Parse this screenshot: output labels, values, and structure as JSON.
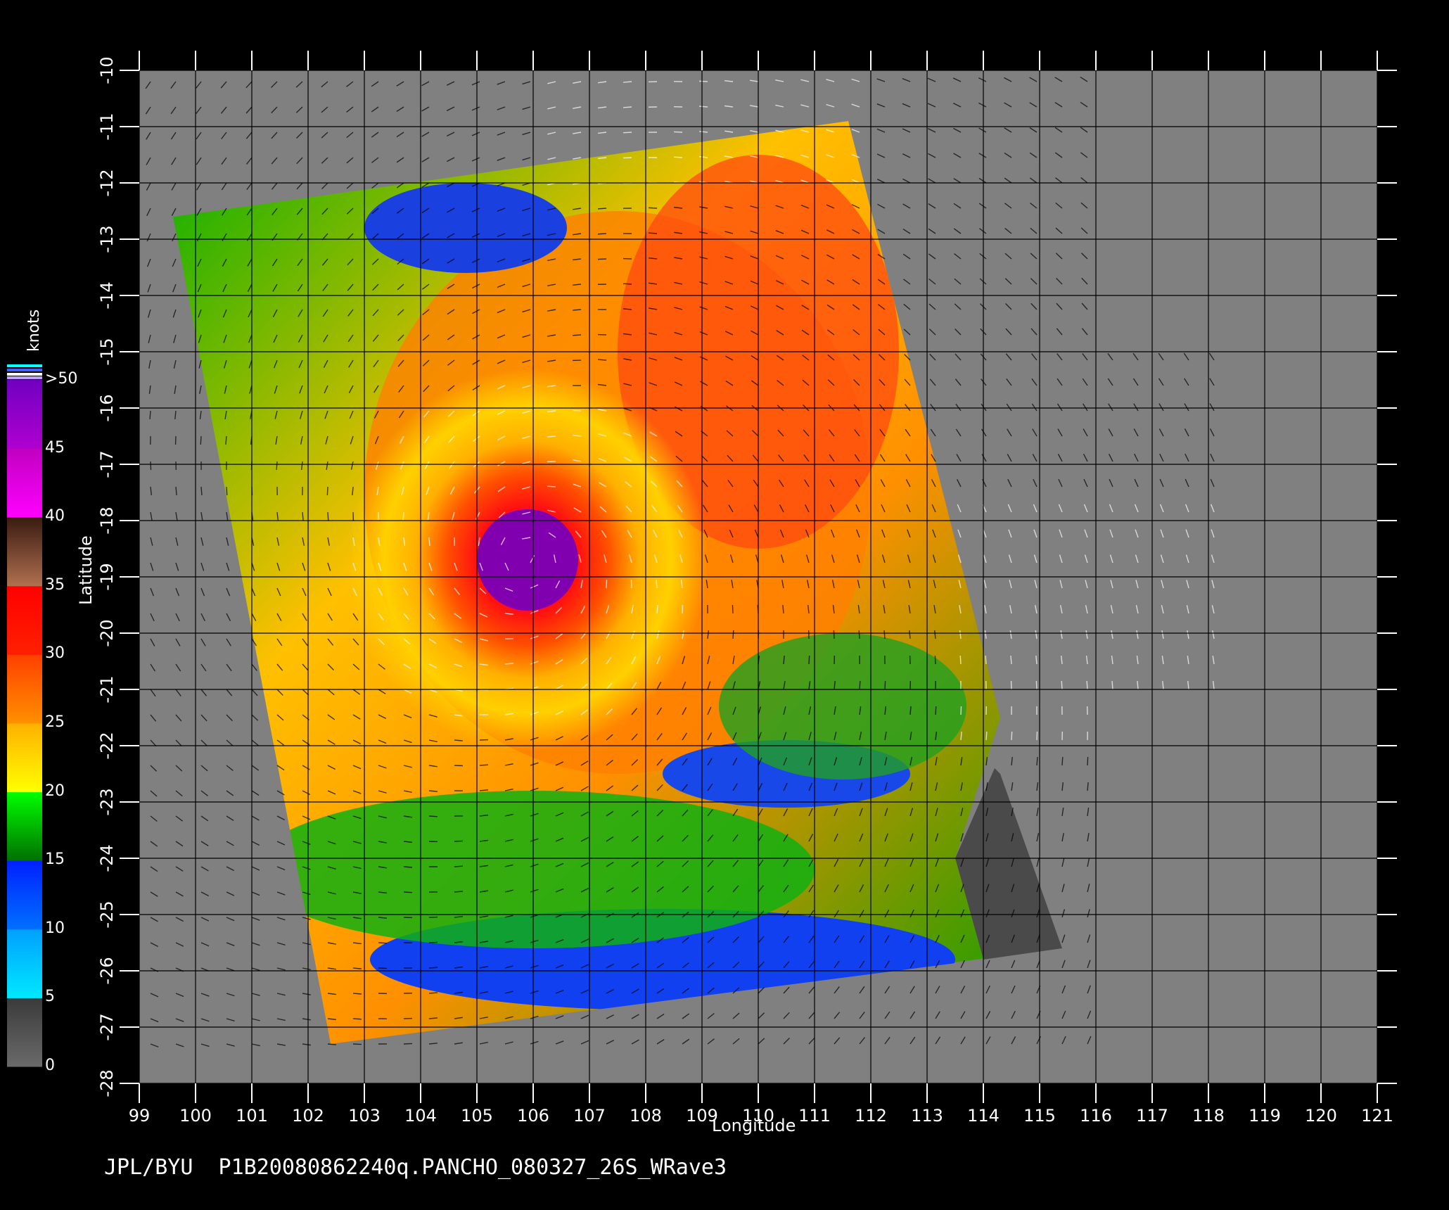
{
  "map": {
    "x_axis_title": "Longitude",
    "y_axis_title": "Latitude",
    "lon_ticks": [
      "99",
      "100",
      "101",
      "102",
      "103",
      "104",
      "105",
      "106",
      "107",
      "108",
      "109",
      "110",
      "111",
      "112",
      "113",
      "114",
      "115",
      "116",
      "117",
      "118",
      "119",
      "120",
      "121"
    ],
    "lat_ticks": [
      "-10",
      "-11",
      "-12",
      "-13",
      "-14",
      "-15",
      "-16",
      "-17",
      "-18",
      "-19",
      "-20",
      "-21",
      "-22",
      "-23",
      "-24",
      "-25",
      "-26",
      "-27",
      "-28"
    ],
    "lon_range": [
      99,
      121
    ],
    "lat_range": [
      -10,
      -28
    ],
    "cyclone_center": {
      "lon": 105.9,
      "lat": -18.7
    }
  },
  "colorbar": {
    "unit": "knots",
    "labels": [
      ">50",
      "45",
      "40",
      "35",
      "30",
      "25",
      "20",
      "15",
      "10",
      "5",
      "0"
    ],
    "segments": [
      {
        "from": 0,
        "to": 5,
        "colors": [
          "#6a6a6a",
          "#3a3a3a"
        ]
      },
      {
        "from": 5,
        "to": 10,
        "colors": [
          "#00e8ff",
          "#00a0ff"
        ]
      },
      {
        "from": 10,
        "to": 15,
        "colors": [
          "#0070ff",
          "#0020ff"
        ]
      },
      {
        "from": 15,
        "to": 20,
        "colors": [
          "#007000",
          "#00ff00"
        ]
      },
      {
        "from": 20,
        "to": 25,
        "colors": [
          "#ffff00",
          "#ffb000"
        ]
      },
      {
        "from": 25,
        "to": 30,
        "colors": [
          "#ff9000",
          "#ff4000"
        ]
      },
      {
        "from": 30,
        "to": 35,
        "colors": [
          "#ff2000",
          "#ff0000"
        ]
      },
      {
        "from": 35,
        "to": 40,
        "colors": [
          "#b07050",
          "#3a1a10"
        ]
      },
      {
        "from": 40,
        "to": 45,
        "colors": [
          "#ff00ff",
          "#c000c0"
        ]
      },
      {
        "from": 45,
        "to": 50,
        "colors": [
          "#b000d0",
          "#7000c0"
        ]
      }
    ]
  },
  "colors": {
    "background": "#000000",
    "land": "#808080",
    "coast": "#4a4a4a",
    "grid": "#000000",
    "axes": "#ffffff"
  },
  "footer": "JPL/BYU  P1B20080862240q.PANCHO_080327_26S_WRave3"
}
